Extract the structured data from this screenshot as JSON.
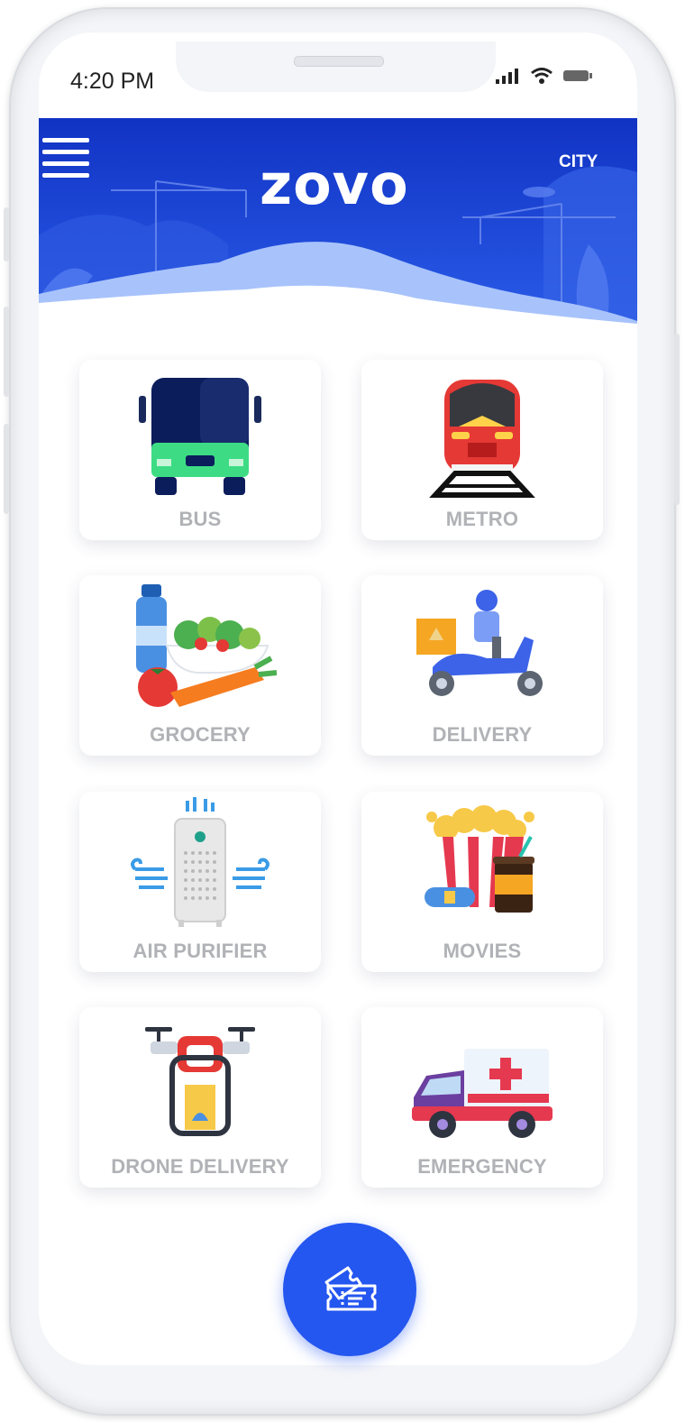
{
  "status_bar": {
    "time": "4:20 PM"
  },
  "header": {
    "logo_text": "zovo",
    "city_label": "CITY"
  },
  "colors": {
    "header_blue": "#1a3fd0",
    "fab_blue": "#2456f0",
    "label_gray": "#b0b2b6"
  },
  "services": [
    {
      "label": "BUS",
      "icon": "bus-icon"
    },
    {
      "label": "METRO",
      "icon": "metro-train-icon"
    },
    {
      "label": "GROCERY",
      "icon": "grocery-icon"
    },
    {
      "label": "DELIVERY",
      "icon": "delivery-scooter-icon"
    },
    {
      "label": "AIR PURIFIER",
      "icon": "air-purifier-icon"
    },
    {
      "label": "MOVIES",
      "icon": "popcorn-icon"
    },
    {
      "label": "DRONE DELIVERY",
      "icon": "drone-icon"
    },
    {
      "label": "EMERGENCY",
      "icon": "ambulance-icon"
    }
  ],
  "fab": {
    "icon": "ticket-icon"
  }
}
